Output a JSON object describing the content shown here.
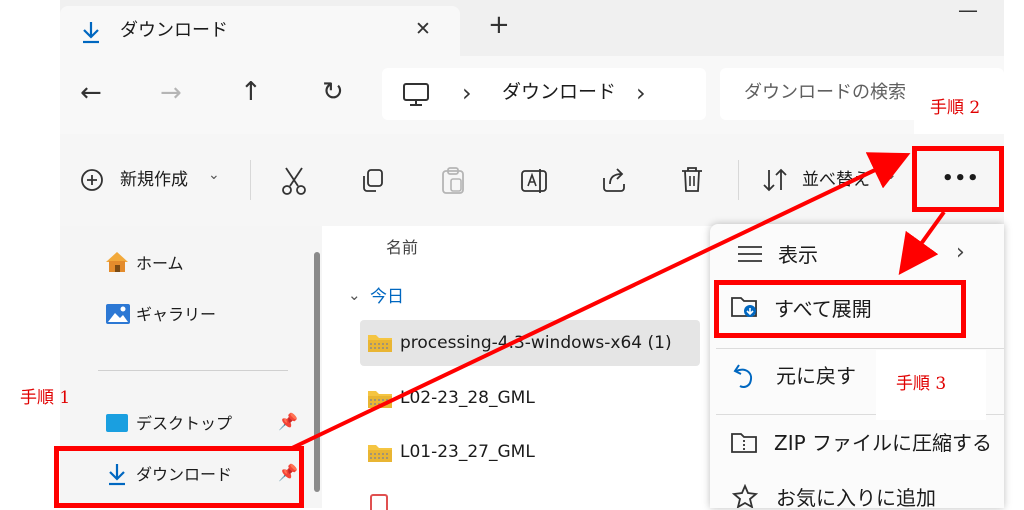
{
  "tab": {
    "title": "ダウンロード",
    "close": "✕",
    "new": "+"
  },
  "window": {
    "minimize": "—"
  },
  "nav": {
    "back": "←",
    "forward": "→",
    "up": "↑",
    "refresh": "↻"
  },
  "address": {
    "sep1": "›",
    "location": "ダウンロード",
    "sep2": "›"
  },
  "search": {
    "placeholder": "ダウンロードの検索"
  },
  "toolbar": {
    "new_label": "新規作成",
    "new_chevron": "⌄",
    "sort_label": "並べ替え",
    "sort_chevron": "⌄",
    "more": "•••"
  },
  "sidebar": {
    "items": [
      {
        "label": "ホーム"
      },
      {
        "label": "ギャラリー"
      },
      {
        "label": "デスクトップ"
      },
      {
        "label": "ダウンロード"
      }
    ]
  },
  "files": {
    "column_name": "名前",
    "group_label": "今日",
    "group_chevron": "⌄",
    "rows": [
      {
        "name": "processing-4.3-windows-x64 (1)"
      },
      {
        "name": "L02-23_28_GML"
      },
      {
        "name": "L01-23_27_GML"
      }
    ]
  },
  "menu": {
    "items": [
      {
        "label": "表示",
        "arrow": "›"
      },
      {
        "label": "すべて展開"
      },
      {
        "label": "元に戻す"
      },
      {
        "label": "ZIP ファイルに圧縮する"
      },
      {
        "label": "お気に入りに追加"
      }
    ]
  },
  "annotations": {
    "step1": "手順 1",
    "step2": "手順 2",
    "step3": "手順 3"
  },
  "colors": {
    "accent": "#0067c0",
    "annotation": "#ff0000",
    "folder": "#f5c542",
    "zip": "#e4a62b"
  }
}
